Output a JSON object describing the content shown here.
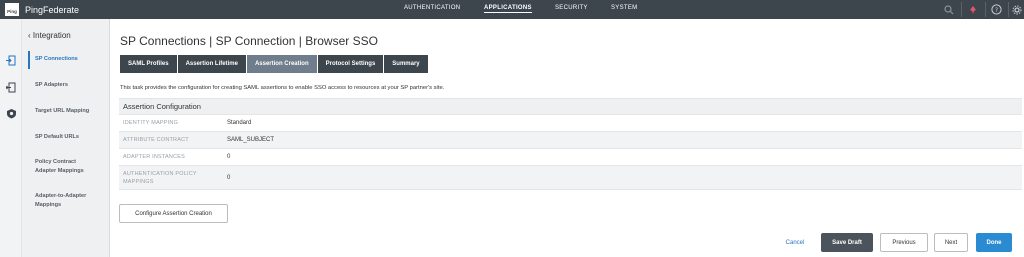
{
  "app": {
    "logo_mark": "Ping",
    "logo_text": "PingFederate"
  },
  "nav": {
    "items": [
      "AUTHENTICATION",
      "APPLICATIONS",
      "SECURITY",
      "SYSTEM"
    ],
    "active": "APPLICATIONS"
  },
  "top_icons": [
    "search-icon",
    "notification-icon",
    "help-icon",
    "settings-icon"
  ],
  "strip_icons": [
    "integration-icon",
    "applications-icon",
    "oauth-icon"
  ],
  "sidebar": {
    "back_label": "Integration",
    "items": [
      {
        "label": "SP Connections",
        "active": true
      },
      {
        "label": "SP Adapters"
      },
      {
        "label": "Target URL Mapping"
      },
      {
        "label": "SP Default URLs"
      },
      {
        "label": "Policy Contract Adapter Mappings"
      },
      {
        "label": "Adapter-to-Adapter Mappings"
      }
    ]
  },
  "page": {
    "title": "SP Connections | SP Connection | Browser SSO",
    "tabs": [
      "SAML Profiles",
      "Assertion Lifetime",
      "Assertion Creation",
      "Protocol Settings",
      "Summary"
    ],
    "active_tab": "Assertion Creation",
    "description": "This task provides the configuration for creating SAML assertions to enable SSO access to resources at your SP partner's site."
  },
  "assertion_config": {
    "heading": "Assertion Configuration",
    "rows": [
      {
        "key": "IDENTITY MAPPING",
        "value": "Standard"
      },
      {
        "key": "ATTRIBUTE CONTRACT",
        "value": "SAML_SUBJECT"
      },
      {
        "key": "ADAPTER INSTANCES",
        "value": "0"
      },
      {
        "key": "AUTHENTICATION POLICY MAPPINGS",
        "value": "0"
      }
    ]
  },
  "configure_button": "Configure Assertion Creation",
  "footer": {
    "cancel": "Cancel",
    "save_draft": "Save Draft",
    "previous": "Previous",
    "next": "Next",
    "done": "Done"
  },
  "colors": {
    "topbar": "#3d454d",
    "accent": "#2676c0",
    "done": "#2a8bd3",
    "active_tab": "#6f7d8c"
  }
}
